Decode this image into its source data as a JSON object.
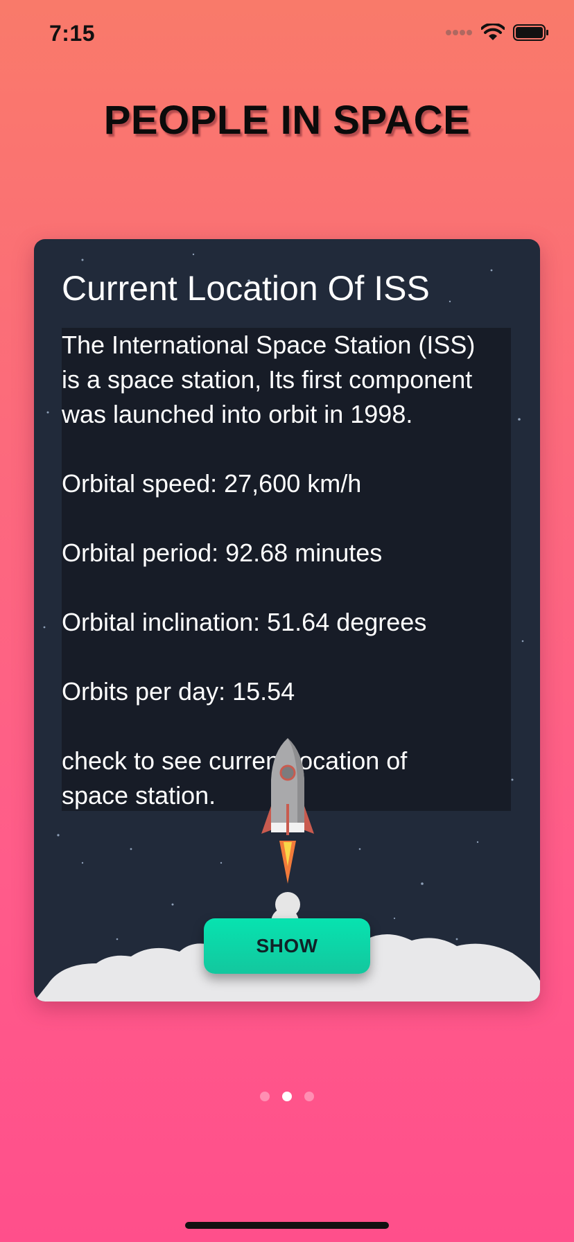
{
  "status_bar": {
    "time": "7:15"
  },
  "header": {
    "title": "PEOPLE IN SPACE"
  },
  "card": {
    "title": "Current Location Of ISS",
    "lines": [
      "The International Space Station (ISS)",
      "is a space station, Its first component",
      "was launched into orbit in 1998.",
      "Orbital speed: 27,600 km/h",
      "Orbital period: 92.68 minutes",
      "Orbital inclination: 51.64 degrees",
      "Orbits per day: 15.54",
      "check to see current location of",
      "space station."
    ],
    "show_label": "SHOW"
  },
  "pagination": {
    "current": 2,
    "total": 3
  },
  "colors": {
    "background_top": "#f97a6a",
    "background_bottom": "#ff4f8b",
    "card": "#212a3a",
    "button": "#07e3b0"
  },
  "icons": [
    "signal-icon",
    "wifi-icon",
    "battery-icon",
    "rocket-icon"
  ]
}
